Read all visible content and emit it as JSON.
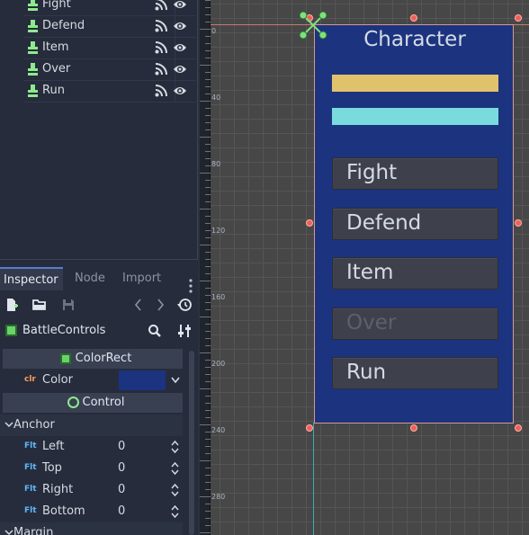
{
  "scene_tree": {
    "items": [
      {
        "label": "Fight"
      },
      {
        "label": "Defend"
      },
      {
        "label": "Item"
      },
      {
        "label": "Over"
      },
      {
        "label": "Run"
      }
    ]
  },
  "dock_tabs": [
    {
      "label": "Inspector",
      "active": true
    },
    {
      "label": "Node",
      "active": false
    },
    {
      "label": "Import",
      "active": false
    }
  ],
  "inspector": {
    "object_name": "BattleControls",
    "colorrect_section": "ColorRect",
    "color_property": {
      "label": "Color",
      "value": "#1c3380"
    },
    "control_section": "Control",
    "anchor_group": "Anchor",
    "type_badge": "Flt",
    "color_badge": "clr",
    "anchor_props": [
      {
        "label": "Left",
        "value": "0"
      },
      {
        "label": "Top",
        "value": "0"
      },
      {
        "label": "Right",
        "value": "0"
      },
      {
        "label": "Bottom",
        "value": "0"
      }
    ],
    "margin_group": "Margin"
  },
  "ruler": {
    "labels": [
      "0",
      "40",
      "80",
      "120",
      "160",
      "200",
      "240",
      "280"
    ]
  },
  "canvas": {
    "title": "Character",
    "hp_bar_color": "#e1c26c",
    "mp_bar_color": "#7adbdc",
    "panel_color": "#1c3380",
    "buttons": [
      {
        "label": "Fight",
        "disabled": false
      },
      {
        "label": "Defend",
        "disabled": false
      },
      {
        "label": "Item",
        "disabled": false
      },
      {
        "label": "Over",
        "disabled": true
      },
      {
        "label": "Run",
        "disabled": false
      }
    ]
  }
}
